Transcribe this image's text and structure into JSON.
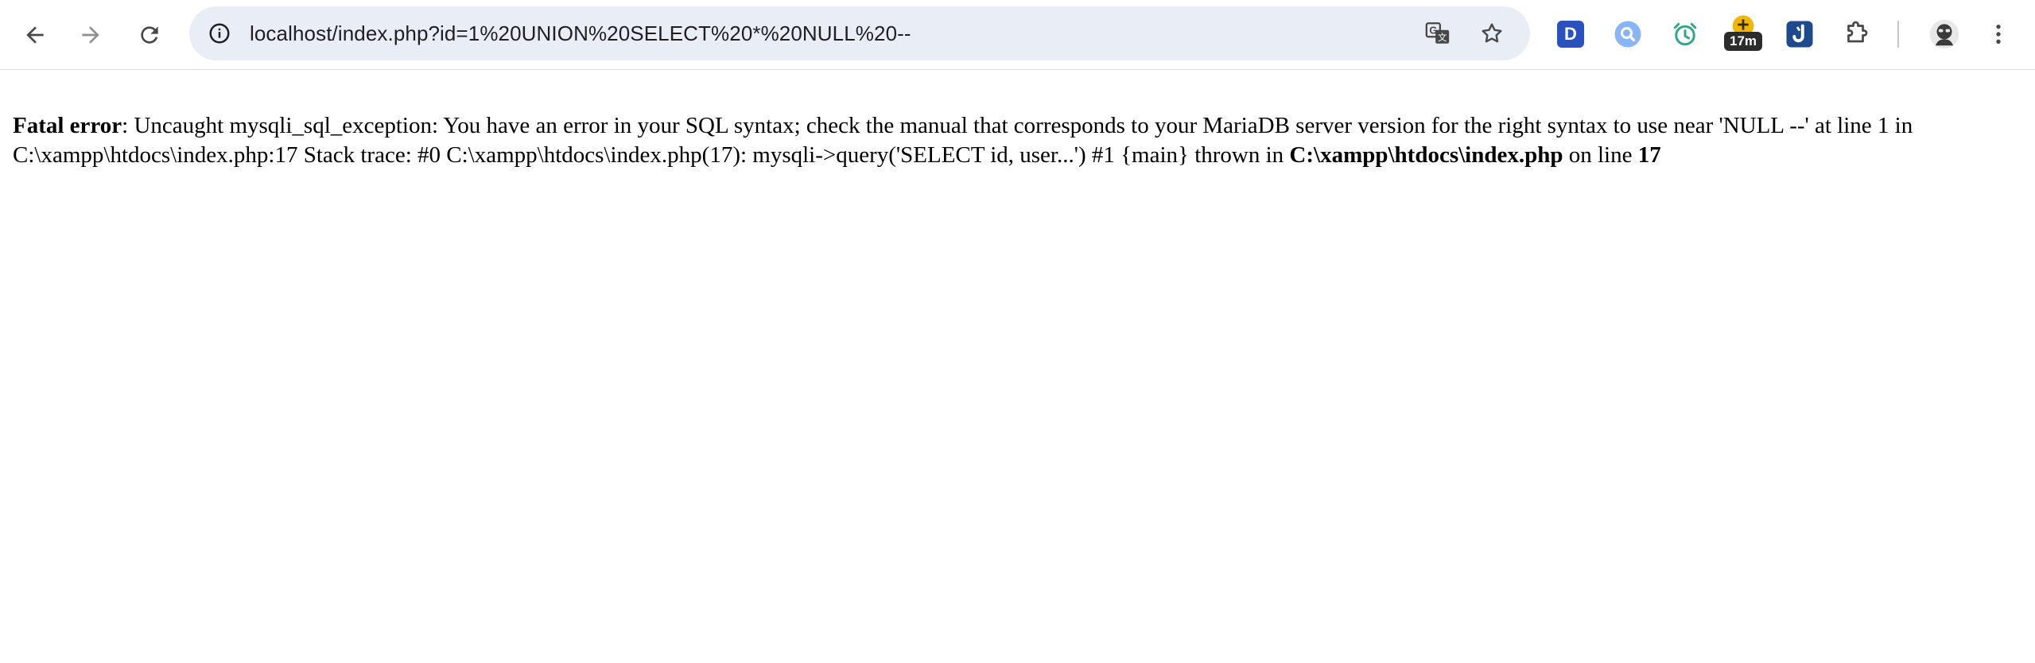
{
  "browser": {
    "url": "localhost/index.php?id=1%20UNION%20SELECT%20*%20NULL%20--",
    "extensions": [
      {
        "name": "d-extension-icon",
        "label": "D"
      },
      {
        "name": "search-extension-icon"
      },
      {
        "name": "alarm-extension-icon"
      },
      {
        "name": "timer-extension-icon",
        "badge": "17m"
      },
      {
        "name": "j-extension-icon"
      }
    ],
    "icons": {
      "back": "back-arrow-icon",
      "forward": "forward-arrow-icon",
      "reload": "reload-icon",
      "info": "info-icon",
      "translate": "translate-icon",
      "bookmark": "star-icon",
      "extensions": "puzzle-icon",
      "profile": "avatar",
      "menu": "kebab-menu-icon"
    }
  },
  "page": {
    "error_label": "Fatal error",
    "message": ": Uncaught mysqli_sql_exception: You have an error in your SQL syntax; check the manual that corresponds to your MariaDB server version for the right syntax to use near 'NULL --' at line 1 in C:\\xampp\\htdocs\\index.php:17 Stack trace: #0 C:\\xampp\\htdocs\\index.php(17): mysqli->query('SELECT id, user...') #1 {main} thrown in ",
    "file": "C:\\xampp\\htdocs\\index.php",
    "on_line_text": " on line ",
    "line": "17"
  },
  "colors": {
    "omnibox_bg": "#e9edf6",
    "icon": "#474747",
    "text": "#000000"
  }
}
